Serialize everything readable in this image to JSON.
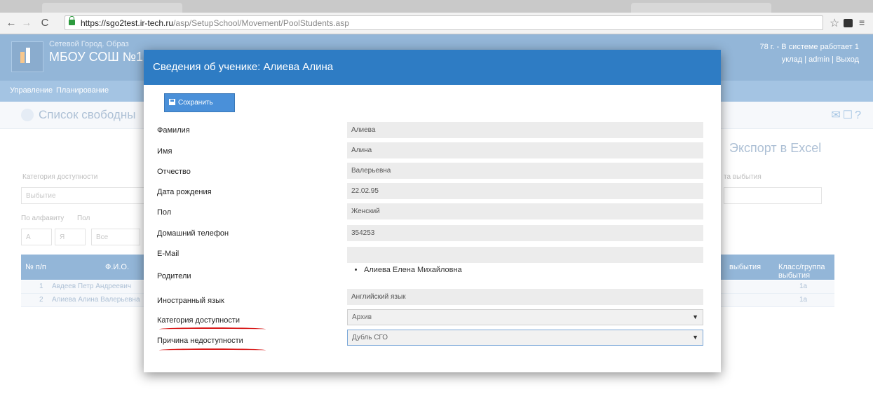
{
  "browser": {
    "url_host": "https://sgo2test.ir-tech.ru",
    "url_path": "/asp/SetupSchool/Movement/PoolStudents.asp"
  },
  "app": {
    "org_small": "Сетевой Город. Образ",
    "title": "МБОУ СОШ №1",
    "right_line1": "78 г. - В системе работает 1",
    "right_line2": "уклад | admin | Выход",
    "menu": [
      "Управление",
      "Планирование"
    ],
    "page_title": "Список свободны",
    "export_label": "Экспорт в Excel",
    "filters": {
      "category_label": "Категория доступности",
      "category_value": "Выбытие",
      "alphabet_label": "По алфавиту",
      "gender_label": "Пол",
      "gender_value": "Все",
      "reason_label": "та выбытия"
    },
    "grid": {
      "headers": [
        "№ п/п",
        "Ф.И.О.",
        "выбытия",
        "Класс/группа выбытия"
      ],
      "rows": [
        {
          "num": "1",
          "name": "Авдеев Петр Андреевич",
          "class": "1а"
        },
        {
          "num": "2",
          "name": "Алиева Алина Валерьевна",
          "class": "1а"
        }
      ]
    }
  },
  "modal": {
    "title": "Сведения об ученике: Алиева Алина",
    "save_label": "Сохранить",
    "fields": [
      {
        "label": "Фамилия",
        "value": "Алиева"
      },
      {
        "label": "Имя",
        "value": "Алина"
      },
      {
        "label": "Отчество",
        "value": "Валерьевна"
      },
      {
        "label": "Дата рождения",
        "value": "22.02.95"
      },
      {
        "label": "Пол",
        "value": "Женский"
      },
      {
        "label": "Домашний телефон",
        "value": "354253"
      },
      {
        "label": "E-Mail",
        "value": ""
      }
    ],
    "parents_label": "Родители",
    "parents": [
      "Алиева Елена Михайловна"
    ],
    "language_label": "Иностранный язык",
    "language_value": "Английский язык",
    "availability_label": "Категория доступности",
    "availability_value": "Архив",
    "reason_label": "Причина недоступности",
    "reason_value": "Дубль СГО"
  },
  "colors": {
    "header_blue": "#2e7cc4",
    "annotation_red": "#d81b1b"
  }
}
